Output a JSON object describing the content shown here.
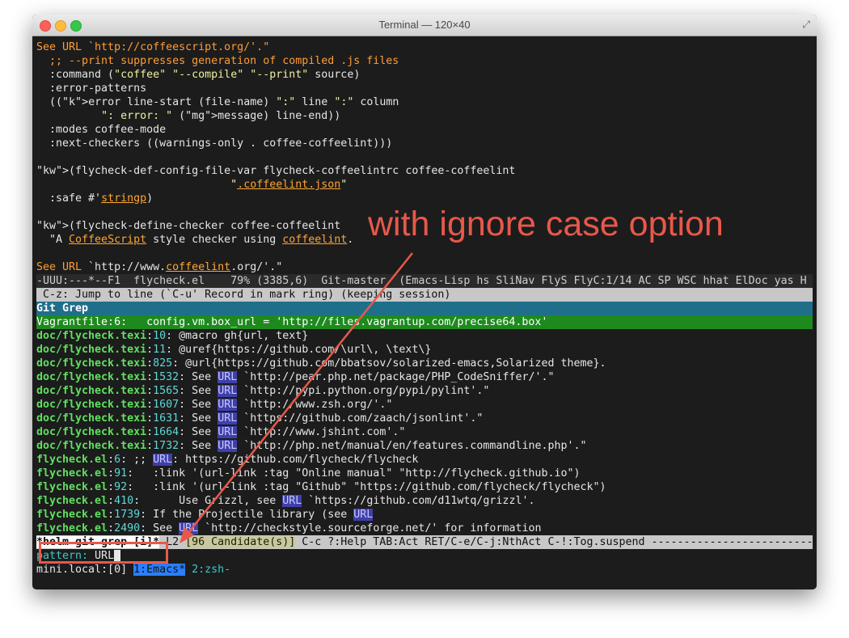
{
  "window": {
    "title": "Terminal — 120×40"
  },
  "annotation": {
    "text": "with ignore case option"
  },
  "editor_lines": [
    [
      "See URL `http://coffeescript.org/'.\"",
      "cm"
    ],
    [
      "  ;; --print suppresses generation of compiled .js files",
      "cm"
    ],
    [
      "  :command (\"coffee\" \"--compile\" \"--print\" source)",
      ""
    ],
    [
      "  :error-patterns",
      ""
    ],
    [
      "  ((error line-start (file-name) \":\" line \":\" column",
      ""
    ],
    [
      "          \": error: \" (message) line-end))",
      ""
    ],
    [
      "  :modes coffee-mode",
      ""
    ],
    [
      "  :next-checkers ((warnings-only . coffee-coffeelint)))",
      ""
    ],
    [
      "",
      ""
    ],
    [
      "(flycheck-def-config-file-var flycheck-coffeelintrc coffee-coffeelint",
      ""
    ],
    [
      "                              \".coffeelint.json\"",
      ""
    ],
    [
      "  :safe #'stringp)",
      ""
    ],
    [
      "",
      ""
    ],
    [
      "(flycheck-define-checker coffee-coffeelint",
      ""
    ],
    [
      "  \"A CoffeeScript style checker using coffeelint.",
      ""
    ],
    [
      "",
      ""
    ],
    [
      "See URL `http://www.coffeelint.org/'.\"",
      ""
    ]
  ],
  "modeline": "-UUU:---*--F1  flycheck.el    79% (3385,6)  Git-master  (Emacs-Lisp hs SliNav FlyS FlyC:1/14 AC SP WSC hhat ElDoc yas H",
  "status_message": " C-z: Jump to line (`C-u' Record in mark ring) (keeping session)",
  "helm_source_title": "Git Grep",
  "selected_result": "Vagrantfile:6:   config.vm.box_url = 'http://files.vagrantup.com/precise64.box'",
  "results": [
    [
      "doc/flycheck.texi",
      "10",
      ": @macro gh{url, text}"
    ],
    [
      "doc/flycheck.texi",
      "11",
      ": @uref{https://github.com/\\url\\, \\text\\}"
    ],
    [
      "doc/flycheck.texi",
      "825",
      ": @url{https://github.com/bbatsov/solarized-emacs,Solarized theme}."
    ],
    [
      "doc/flycheck.texi",
      "1532",
      ": See URL `http://pear.php.net/package/PHP_CodeSniffer/'.\""
    ],
    [
      "doc/flycheck.texi",
      "1565",
      ": See URL `http://pypi.python.org/pypi/pylint'.\""
    ],
    [
      "doc/flycheck.texi",
      "1607",
      ": See URL `http://www.zsh.org/'.\""
    ],
    [
      "doc/flycheck.texi",
      "1631",
      ": See URL `https://github.com/zaach/jsonlint'.\""
    ],
    [
      "doc/flycheck.texi",
      "1664",
      ": See URL `http://www.jshint.com'.\""
    ],
    [
      "doc/flycheck.texi",
      "1732",
      ": See URL `http://php.net/manual/en/features.commandline.php'.\""
    ],
    [
      "flycheck.el",
      "6",
      ": ;; URL: https://github.com/flycheck/flycheck"
    ],
    [
      "flycheck.el",
      "91",
      ":   :link '(url-link :tag \"Online manual\" \"http://flycheck.github.io\")"
    ],
    [
      "flycheck.el",
      "92",
      ":   :link '(url-link :tag \"Github\" \"https://github.com/flycheck/flycheck\")"
    ],
    [
      "flycheck.el",
      "410",
      ":      Use Grizzl, see URL `https://github.com/d11wtq/grizzl'."
    ],
    [
      "flycheck.el",
      "1739",
      ": If the Projectile library (see URL"
    ],
    [
      "flycheck.el",
      "2490",
      ": See URL `http://checkstyle.sourceforge.net/' for information"
    ]
  ],
  "helm_bar": {
    "name": "*helm git grep [i]*",
    "line": " L2 ",
    "candidates": "[96 Candidate(s)]",
    "help": " C-c ?:Help TAB:Act RET/C-e/C-j:NthAct C-!:Tog.suspend ---------------------------------------------"
  },
  "pattern": {
    "label": "pattern:",
    "value": " URL"
  },
  "tmux": {
    "host": "mini.local:[0] ",
    "win1": "1:Emacs*",
    "win2": " 2:zsh-"
  }
}
